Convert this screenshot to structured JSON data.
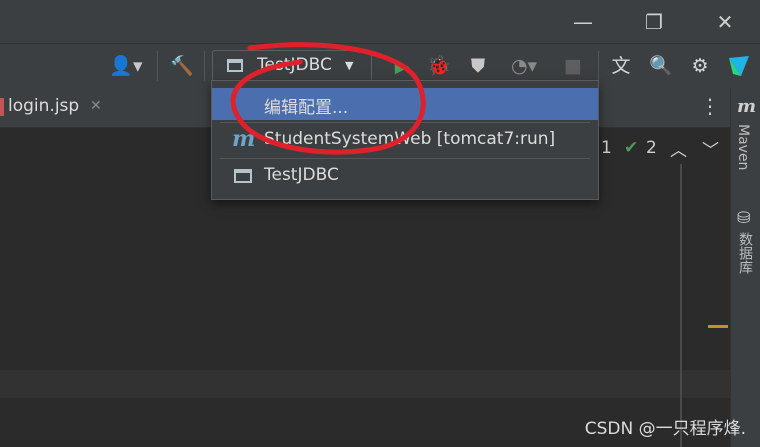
{
  "window": {
    "minimize": "—",
    "restore": "❐",
    "close": "✕"
  },
  "toolbar": {
    "run_config": "TestJDBC"
  },
  "tabs": [
    {
      "label": "login.jsp",
      "close": "✕"
    }
  ],
  "editor": {
    "problems_count": "1",
    "checks_count": "2"
  },
  "right_panel": {
    "maven": "Maven",
    "database": "数据库"
  },
  "popup": {
    "items": [
      {
        "label": "编辑配置..."
      },
      {
        "label": "StudentSystemWeb [tomcat7:run]"
      },
      {
        "label": "TestJDBC"
      }
    ]
  },
  "watermark": "CSDN @一只程序烽.",
  "colors": {
    "accent": "#4b6eaf",
    "annotation": "#e0202a",
    "run": "#499c54"
  }
}
